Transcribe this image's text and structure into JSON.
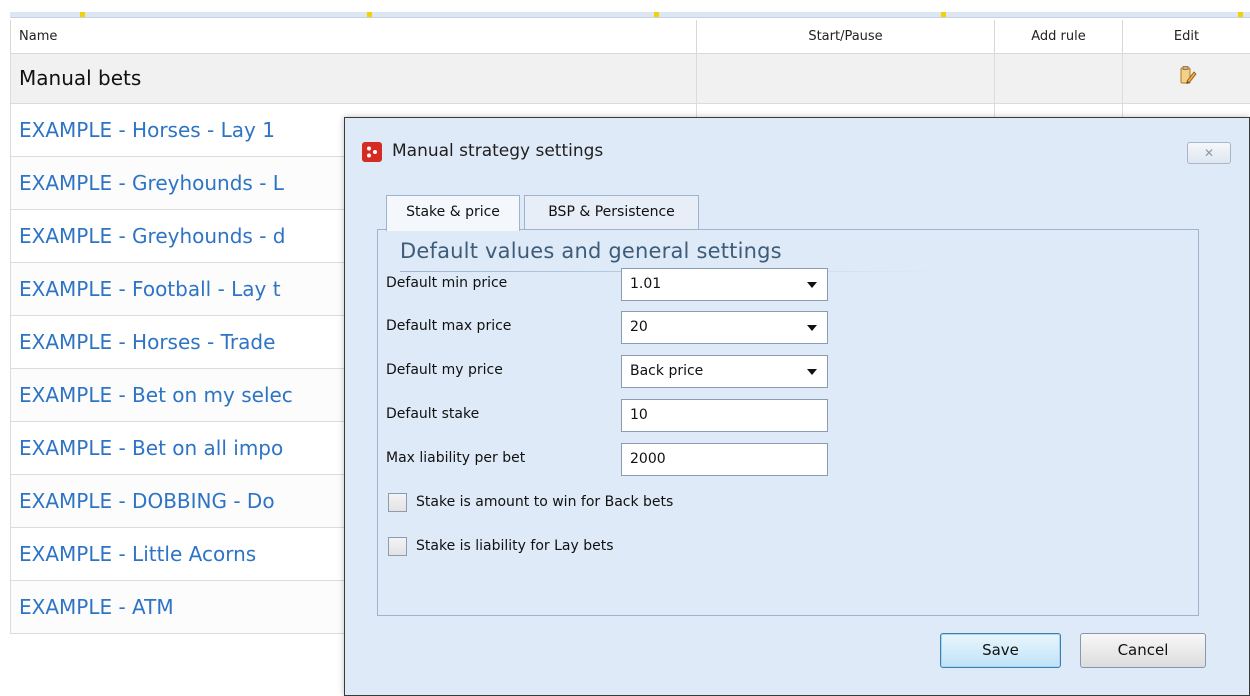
{
  "grid": {
    "headers": {
      "name": "Name",
      "start_pause": "Start/Pause",
      "add_rule": "Add rule",
      "edit": "Edit"
    },
    "manual_row": {
      "name": "Manual bets",
      "edit_icon": "edit-pencil-icon"
    },
    "rows": [
      {
        "name": "EXAMPLE - Horses - Lay 1"
      },
      {
        "name": "EXAMPLE - Greyhounds - L"
      },
      {
        "name": "EXAMPLE - Greyhounds - d"
      },
      {
        "name": "EXAMPLE - Football - Lay t"
      },
      {
        "name": "EXAMPLE - Horses - Trade"
      },
      {
        "name": "EXAMPLE - Bet on my selec"
      },
      {
        "name": "EXAMPLE - Bet on all impo"
      },
      {
        "name": "EXAMPLE - DOBBING - Do"
      },
      {
        "name": "EXAMPLE - Little Acorns"
      },
      {
        "name": "EXAMPLE - ATM"
      }
    ]
  },
  "dialog": {
    "title": "Manual strategy settings",
    "close_glyph": "✕",
    "tabs": [
      {
        "label": "Stake & price",
        "active": true
      },
      {
        "label": "BSP & Persistence",
        "active": false
      }
    ],
    "section_title": "Default values and general settings",
    "fields": [
      {
        "label": "Default min price",
        "value": "1.01",
        "dropdown": true
      },
      {
        "label": "Default max price",
        "value": "20",
        "dropdown": true
      },
      {
        "label": "Default my price",
        "value": "Back price",
        "dropdown": true
      },
      {
        "label": "Default stake",
        "value": "10",
        "dropdown": false
      },
      {
        "label": "Max liability per bet",
        "value": "2000",
        "dropdown": false
      }
    ],
    "checkboxes": [
      {
        "label": "Stake is amount to win for Back bets",
        "checked": false
      },
      {
        "label": "Stake is liability for Lay bets",
        "checked": false
      }
    ],
    "buttons": {
      "save": "Save",
      "cancel": "Cancel"
    }
  },
  "colors": {
    "link_blue": "#2e74c5",
    "dialog_bg": "#dfeaf8",
    "logo_red": "#d62b22"
  }
}
